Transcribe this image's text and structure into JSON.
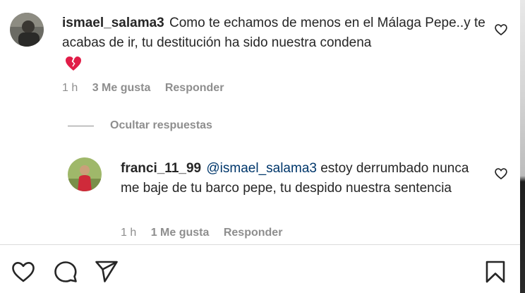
{
  "comments": [
    {
      "username": "ismael_salama3",
      "text": "Como te echamos de menos en el Málaga Pepe..y te acabas de ir, tu destitución ha sido nuestra condena",
      "emoji": "💔",
      "time": "1 h",
      "likes": "3 Me gusta",
      "reply": "Responder"
    }
  ],
  "toggle_replies": "Ocultar respuestas",
  "replies": [
    {
      "username": "franci_11_99",
      "mention": "@ismael_salama3",
      "text": " estoy derrumbado nunca me baje de tu barco pepe, tu despido nuestra sentencia",
      "time": "1 h",
      "likes": "1 Me gusta",
      "reply": "Responder"
    }
  ],
  "icons": {
    "like": "heart-icon",
    "comment": "comment-icon",
    "share": "share-icon",
    "save": "bookmark-icon",
    "broken_heart": "broken-heart-icon"
  },
  "colors": {
    "text": "#262626",
    "muted": "#8e8e8e",
    "mention": "#00376b",
    "broken_heart": "#e11d48"
  }
}
